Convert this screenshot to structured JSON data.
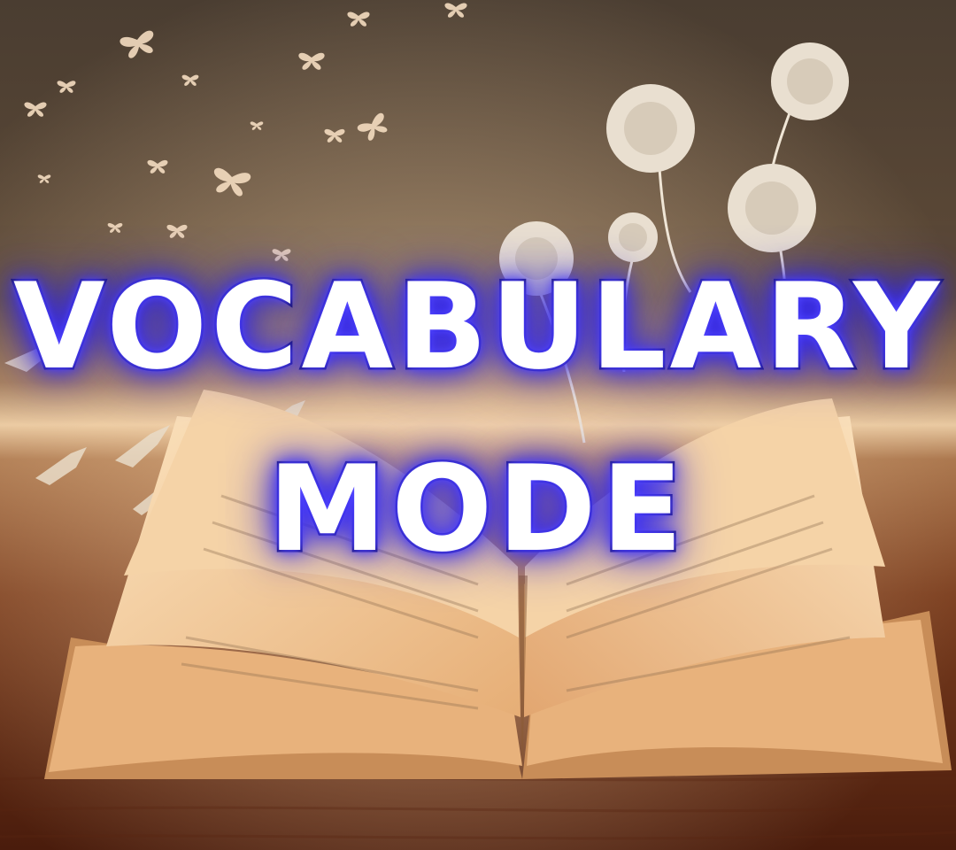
{
  "title": {
    "line1": "VOCABULARY",
    "line2": "MODE"
  },
  "colors": {
    "text_fill": "#ffffff",
    "text_outline": "#16143a",
    "glow": "#3f33ff",
    "background_top": "#3a3026",
    "table_wood": "#7a3a1c",
    "page_paper": "#f3c99a"
  },
  "decorations": {
    "butterflies": "butterfly-icon",
    "paper_flowers": "paper-rose-icon"
  }
}
